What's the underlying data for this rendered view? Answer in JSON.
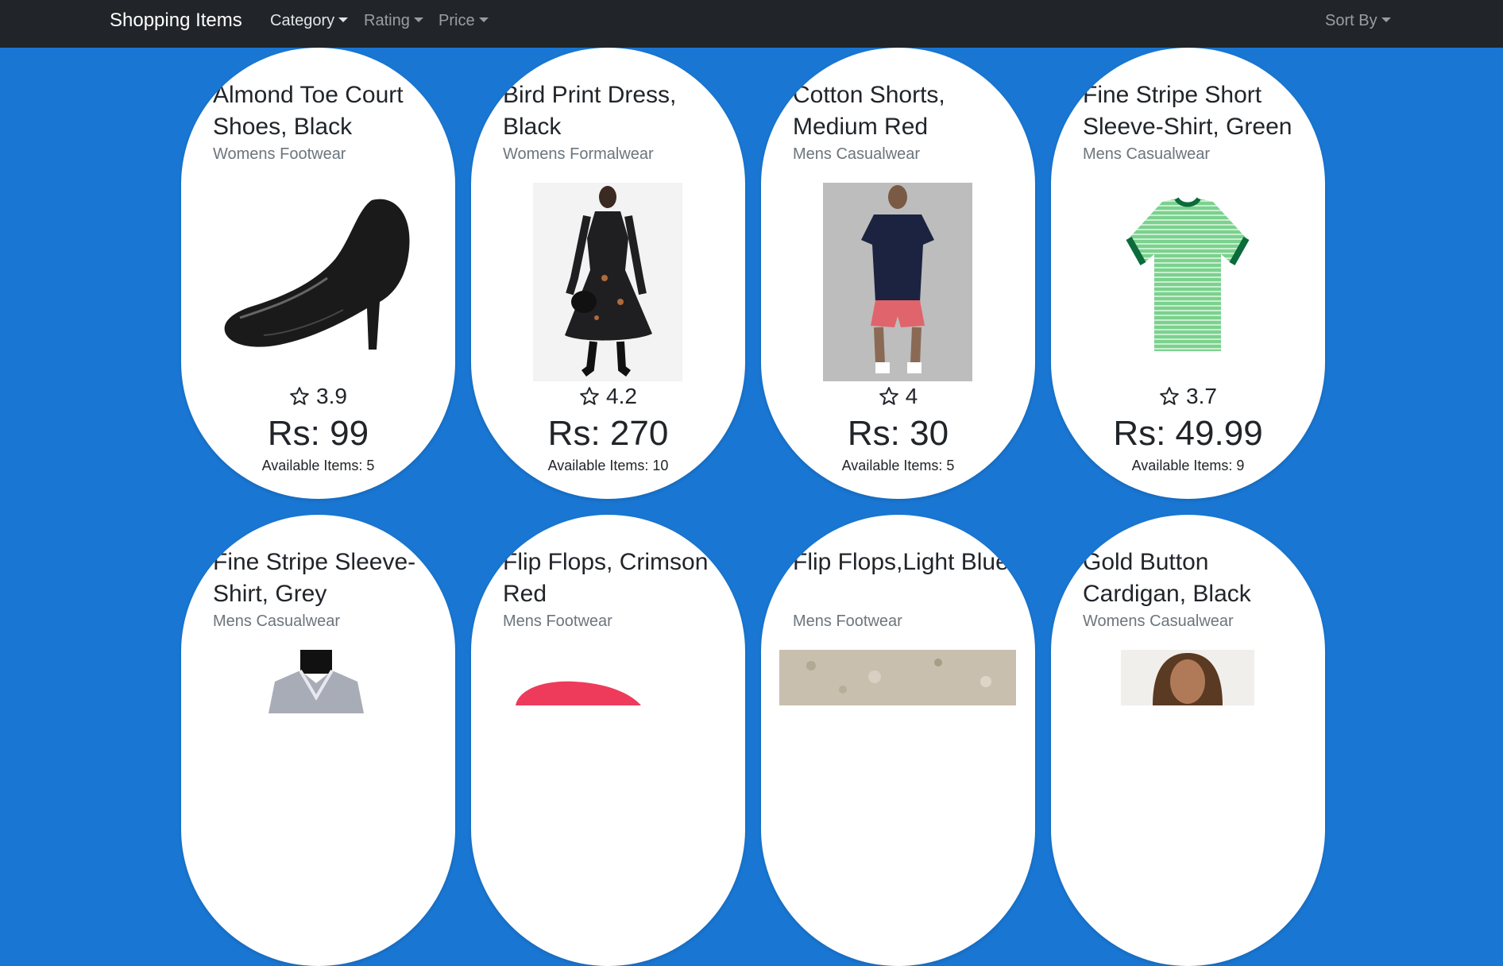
{
  "navbar": {
    "brand": "Shopping Items",
    "menus": [
      {
        "label": "Category"
      },
      {
        "label": "Rating"
      },
      {
        "label": "Price"
      }
    ],
    "sort_label": "Sort By"
  },
  "products": [
    {
      "name": "Almond Toe Court Shoes, Black",
      "category": "Womens Footwear",
      "rating": "3.9",
      "price": "Rs: 99",
      "available": "Available Items: 5",
      "image_icon": "black-heel-shoe"
    },
    {
      "name": "Bird Print Dress, Black",
      "category": "Womens Formalwear",
      "rating": "4.2",
      "price": "Rs: 270",
      "available": "Available Items: 10",
      "image_icon": "black-dress-model"
    },
    {
      "name": "Cotton Shorts, Medium Red",
      "category": "Mens Casualwear",
      "rating": "4",
      "price": "Rs: 30",
      "available": "Available Items: 5",
      "image_icon": "man-red-shorts"
    },
    {
      "name": "Fine Stripe Short Sleeve-Shirt, Green",
      "category": "Mens Casualwear",
      "rating": "3.7",
      "price": "Rs: 49.99",
      "available": "Available Items: 9",
      "image_icon": "green-striped-tshirt"
    },
    {
      "name": "Fine Stripe Sleeve-Shirt, Grey",
      "category": "Mens Casualwear",
      "image_icon": "grey-shirt-mannequin"
    },
    {
      "name": "Flip Flops, Crimson Red",
      "category": "Mens Footwear",
      "image_icon": "red-flip-flop"
    },
    {
      "name": "Flip Flops,Light Blue",
      "category": "Mens Footwear",
      "image_icon": "sand-photo"
    },
    {
      "name": "Gold Button Cardigan, Black",
      "category": "Womens Casualwear",
      "image_icon": "woman-portrait"
    }
  ],
  "colors": {
    "background": "#1976d2",
    "navbar": "#212529",
    "card": "#ffffff"
  }
}
